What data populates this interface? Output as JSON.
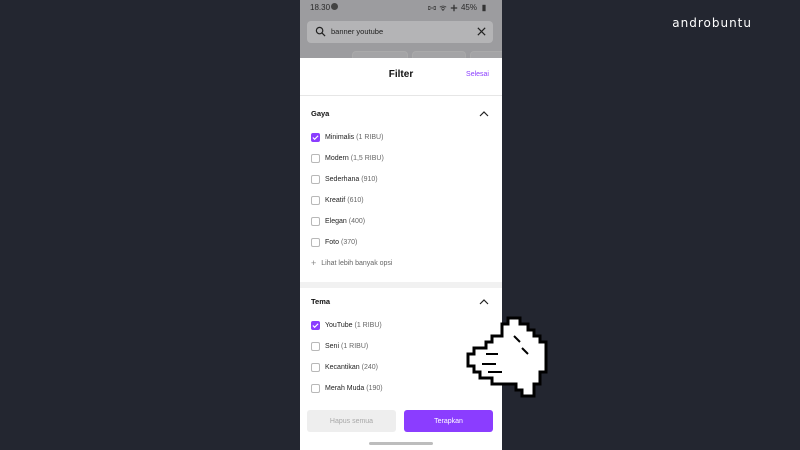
{
  "watermark": "androbuntu",
  "status_bar": {
    "time": "18.30",
    "battery": "45%"
  },
  "search": {
    "query": "banner youtube"
  },
  "filter_sheet": {
    "title": "Filter",
    "done_label": "Selesai",
    "sections": [
      {
        "title": "Gaya",
        "options": [
          {
            "label": "Minimalis",
            "count": "(1 RIBU)",
            "checked": true
          },
          {
            "label": "Modern",
            "count": "(1,5 RIBU)",
            "checked": false
          },
          {
            "label": "Sederhana",
            "count": "(910)",
            "checked": false
          },
          {
            "label": "Kreatif",
            "count": "(610)",
            "checked": false
          },
          {
            "label": "Elegan",
            "count": "(400)",
            "checked": false
          },
          {
            "label": "Foto",
            "count": "(370)",
            "checked": false
          }
        ],
        "more_label": "Lihat lebih banyak opsi"
      },
      {
        "title": "Tema",
        "options": [
          {
            "label": "YouTube",
            "count": "(1 RIBU)",
            "checked": true
          },
          {
            "label": "Seni",
            "count": "(1 RIBU)",
            "checked": false
          },
          {
            "label": "Kecantikan",
            "count": "(240)",
            "checked": false
          },
          {
            "label": "Merah Muda",
            "count": "(190)",
            "checked": false
          }
        ]
      }
    ],
    "clear_all_label": "Hapus semua",
    "apply_label": "Terapkan"
  },
  "colors": {
    "accent": "#8b3dff",
    "backdrop": "#232630"
  }
}
